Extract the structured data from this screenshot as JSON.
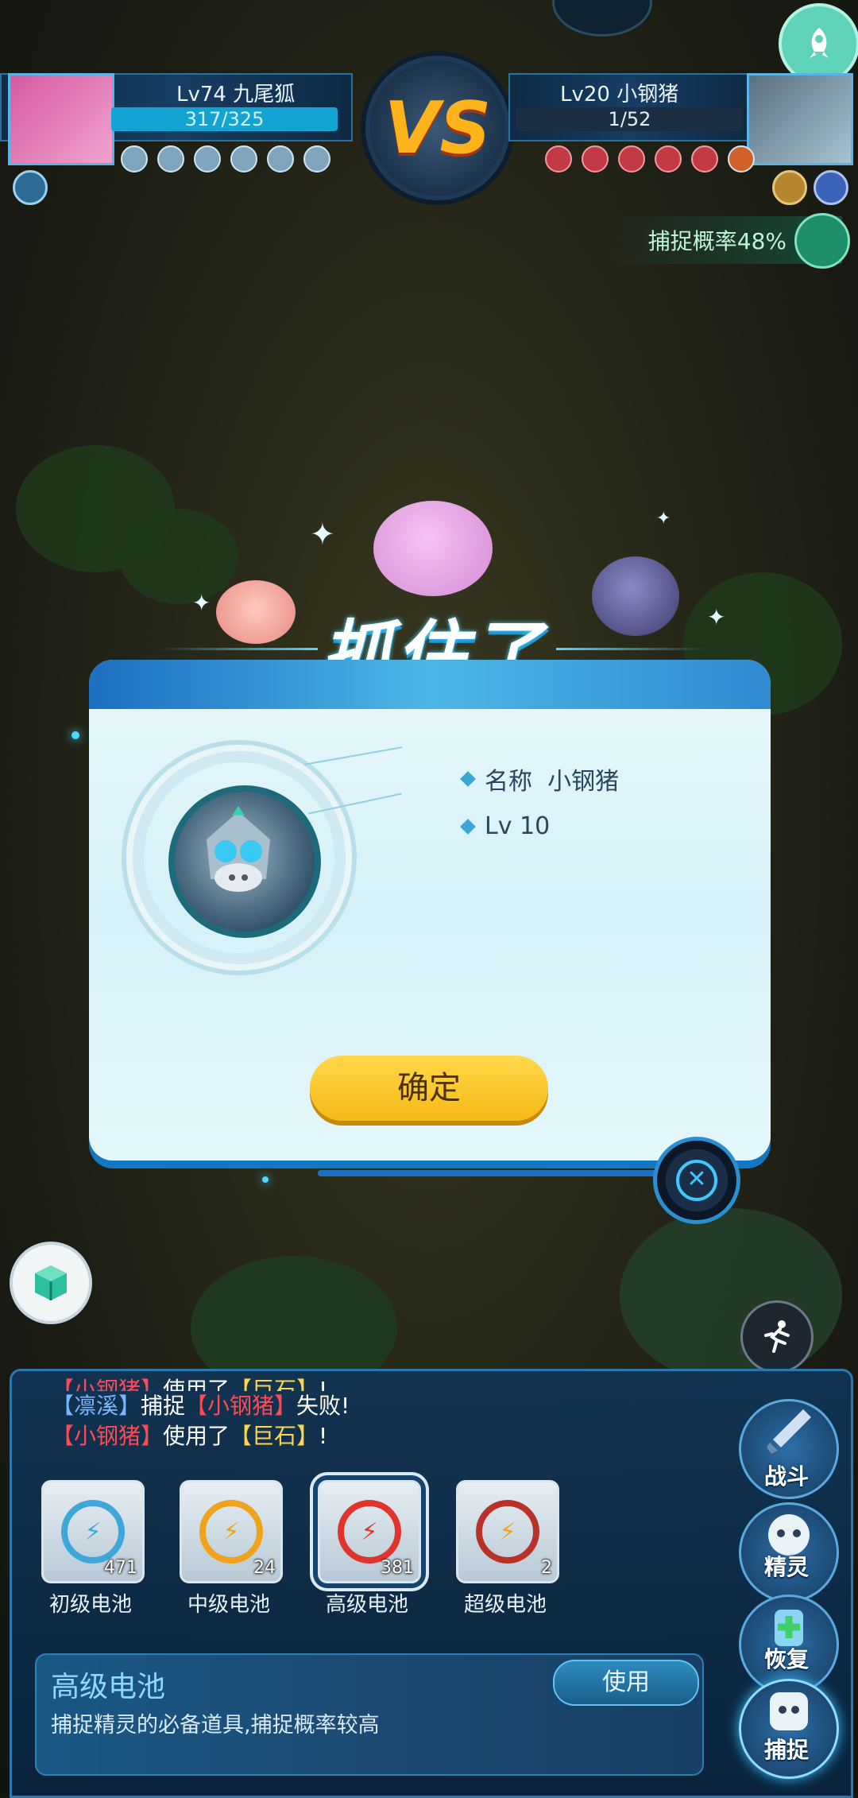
{
  "hud": {
    "player": {
      "level_name": "Lv74 九尾狐",
      "hp": "317/325"
    },
    "enemy": {
      "level_name": "Lv20 小钢猪",
      "hp": "1/52"
    },
    "vs_text": "VS",
    "capture_rate": "捕捉概率48%"
  },
  "dialog": {
    "title": "抓住了",
    "name_line": "名称  小钢猪",
    "level_line": "Lv 10",
    "confirm_label": "确定",
    "close_glyph": "✕"
  },
  "battle_log": [
    {
      "actor": "【小钢猪】",
      "verb": "使用了",
      "object": "【巨石】",
      "tail": "!"
    },
    {
      "actor": "【凛溪】",
      "verb": "捕捉",
      "object": "【小钢猪】",
      "tail": "失败!"
    },
    {
      "actor": "【小钢猪】",
      "verb": "使用了",
      "object": "【巨石】",
      "tail": "!"
    }
  ],
  "items": [
    {
      "label": "初级电池",
      "count": "471",
      "color": "#3ea6d8"
    },
    {
      "label": "中级电池",
      "count": "24",
      "color": "#f0a21a"
    },
    {
      "label": "高级电池",
      "count": "381",
      "color": "#e0352d"
    },
    {
      "label": "超级电池",
      "count": "2",
      "color": "#b8322a"
    }
  ],
  "selected_item": {
    "title": "高级电池",
    "description": "捕捉精灵的必备道具,捕捉概率较高",
    "use_label": "使用"
  },
  "actions": {
    "fight": "战斗",
    "spirit": "精灵",
    "heal": "恢复",
    "capture": "捕捉"
  },
  "icons": {
    "rocket": "rocket-icon",
    "cube": "cube-icon",
    "run": "run-icon",
    "lightning": "⚡"
  }
}
